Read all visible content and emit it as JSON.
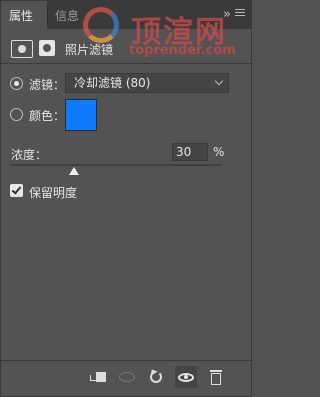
{
  "tabs": [
    {
      "label": "属性"
    },
    {
      "label": "信息"
    }
  ],
  "tabbar": {
    "collapse_glyph": "»"
  },
  "watermark": {
    "main": "顶渲网",
    "sub": "toprender.com"
  },
  "header": {
    "title": "照片滤镜",
    "icons": [
      "adjustment-camera-icon",
      "mask-icon"
    ]
  },
  "filter": {
    "label": "滤镜：",
    "value": "冷却滤镜 (80)",
    "selected": true
  },
  "color": {
    "label": "颜色：",
    "value": "#0e7bff",
    "selected": false
  },
  "density": {
    "label": "浓度：",
    "value": "30",
    "unit": "%",
    "slider_fraction": 0.3
  },
  "preserve": {
    "label": "保留明度",
    "checked": true
  },
  "toolbar": [
    "clip-to-layer-icon",
    "view-previous-icon",
    "reset-icon",
    "visibility-eye-icon",
    "trash-icon"
  ],
  "colors": {
    "panel": "#535353",
    "tabbar": "#3a3a3a",
    "swatch": "#0e7bff"
  }
}
